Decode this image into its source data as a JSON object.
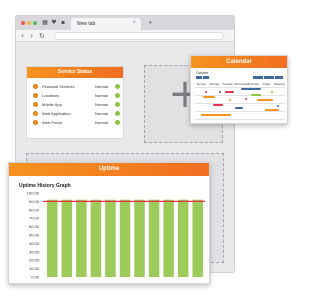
{
  "browser": {
    "tab_title": "New tab",
    "tab_close": "×",
    "new_tab": "+",
    "nav_back": "‹",
    "nav_forward": "›",
    "nav_reload": "↻",
    "traffic_colors": [
      "#f05a4a",
      "#f6b93b",
      "#59b96b"
    ]
  },
  "service_status": {
    "title": "Service Status",
    "items": [
      {
        "name": "Financial Services",
        "status": "Normal"
      },
      {
        "name": "Locations",
        "status": "Normal"
      },
      {
        "name": "Mobile App",
        "status": "Normal"
      },
      {
        "name": "Web Application",
        "status": "Normal"
      },
      {
        "name": "Web Portal",
        "status": "Normal"
      }
    ]
  },
  "dropzone": {
    "icon": "+"
  },
  "calendar": {
    "title": "Calendar",
    "month": "October",
    "days": [
      "Sunday",
      "Monday",
      "Tuesday",
      "Wednesday",
      "Thursday",
      "Friday",
      "Saturday"
    ]
  },
  "uptime": {
    "title": "Uptime",
    "graph_title": "Uptime History Graph"
  },
  "colors": {
    "accent_orange": "#f7931e",
    "bar_green": "#9dcb5a",
    "threshold_red": "#e8334a",
    "calendar_blue": "#3c6aa0"
  },
  "chart_data": {
    "type": "bar",
    "title": "Uptime History Graph",
    "ylim": [
      0,
      100
    ],
    "yticks": [
      "100.00",
      "90.00",
      "80.00",
      "70.00",
      "60.00",
      "50.00",
      "40.00",
      "30.00",
      "20.00",
      "10.00",
      "0.00"
    ],
    "values": [
      92,
      92,
      92,
      92,
      92,
      92,
      92,
      92,
      92,
      92,
      92
    ],
    "threshold": 90,
    "grid": false,
    "legend": "none"
  }
}
